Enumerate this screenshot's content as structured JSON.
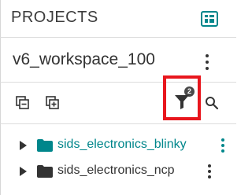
{
  "header": {
    "title": "PROJECTS"
  },
  "workspace": {
    "name": "v6_workspace_100"
  },
  "toolbar": {
    "filter_badge": "2"
  },
  "tree": {
    "items": [
      {
        "label": "sids_electronics_blinky",
        "color": "#00868b",
        "folder_color": "#00868b"
      },
      {
        "label": "sids_electronics_ncp",
        "color": "#333333",
        "folder_color": "#333333"
      }
    ]
  },
  "colors": {
    "accent": "#00868b",
    "highlight": "#e8161d"
  }
}
